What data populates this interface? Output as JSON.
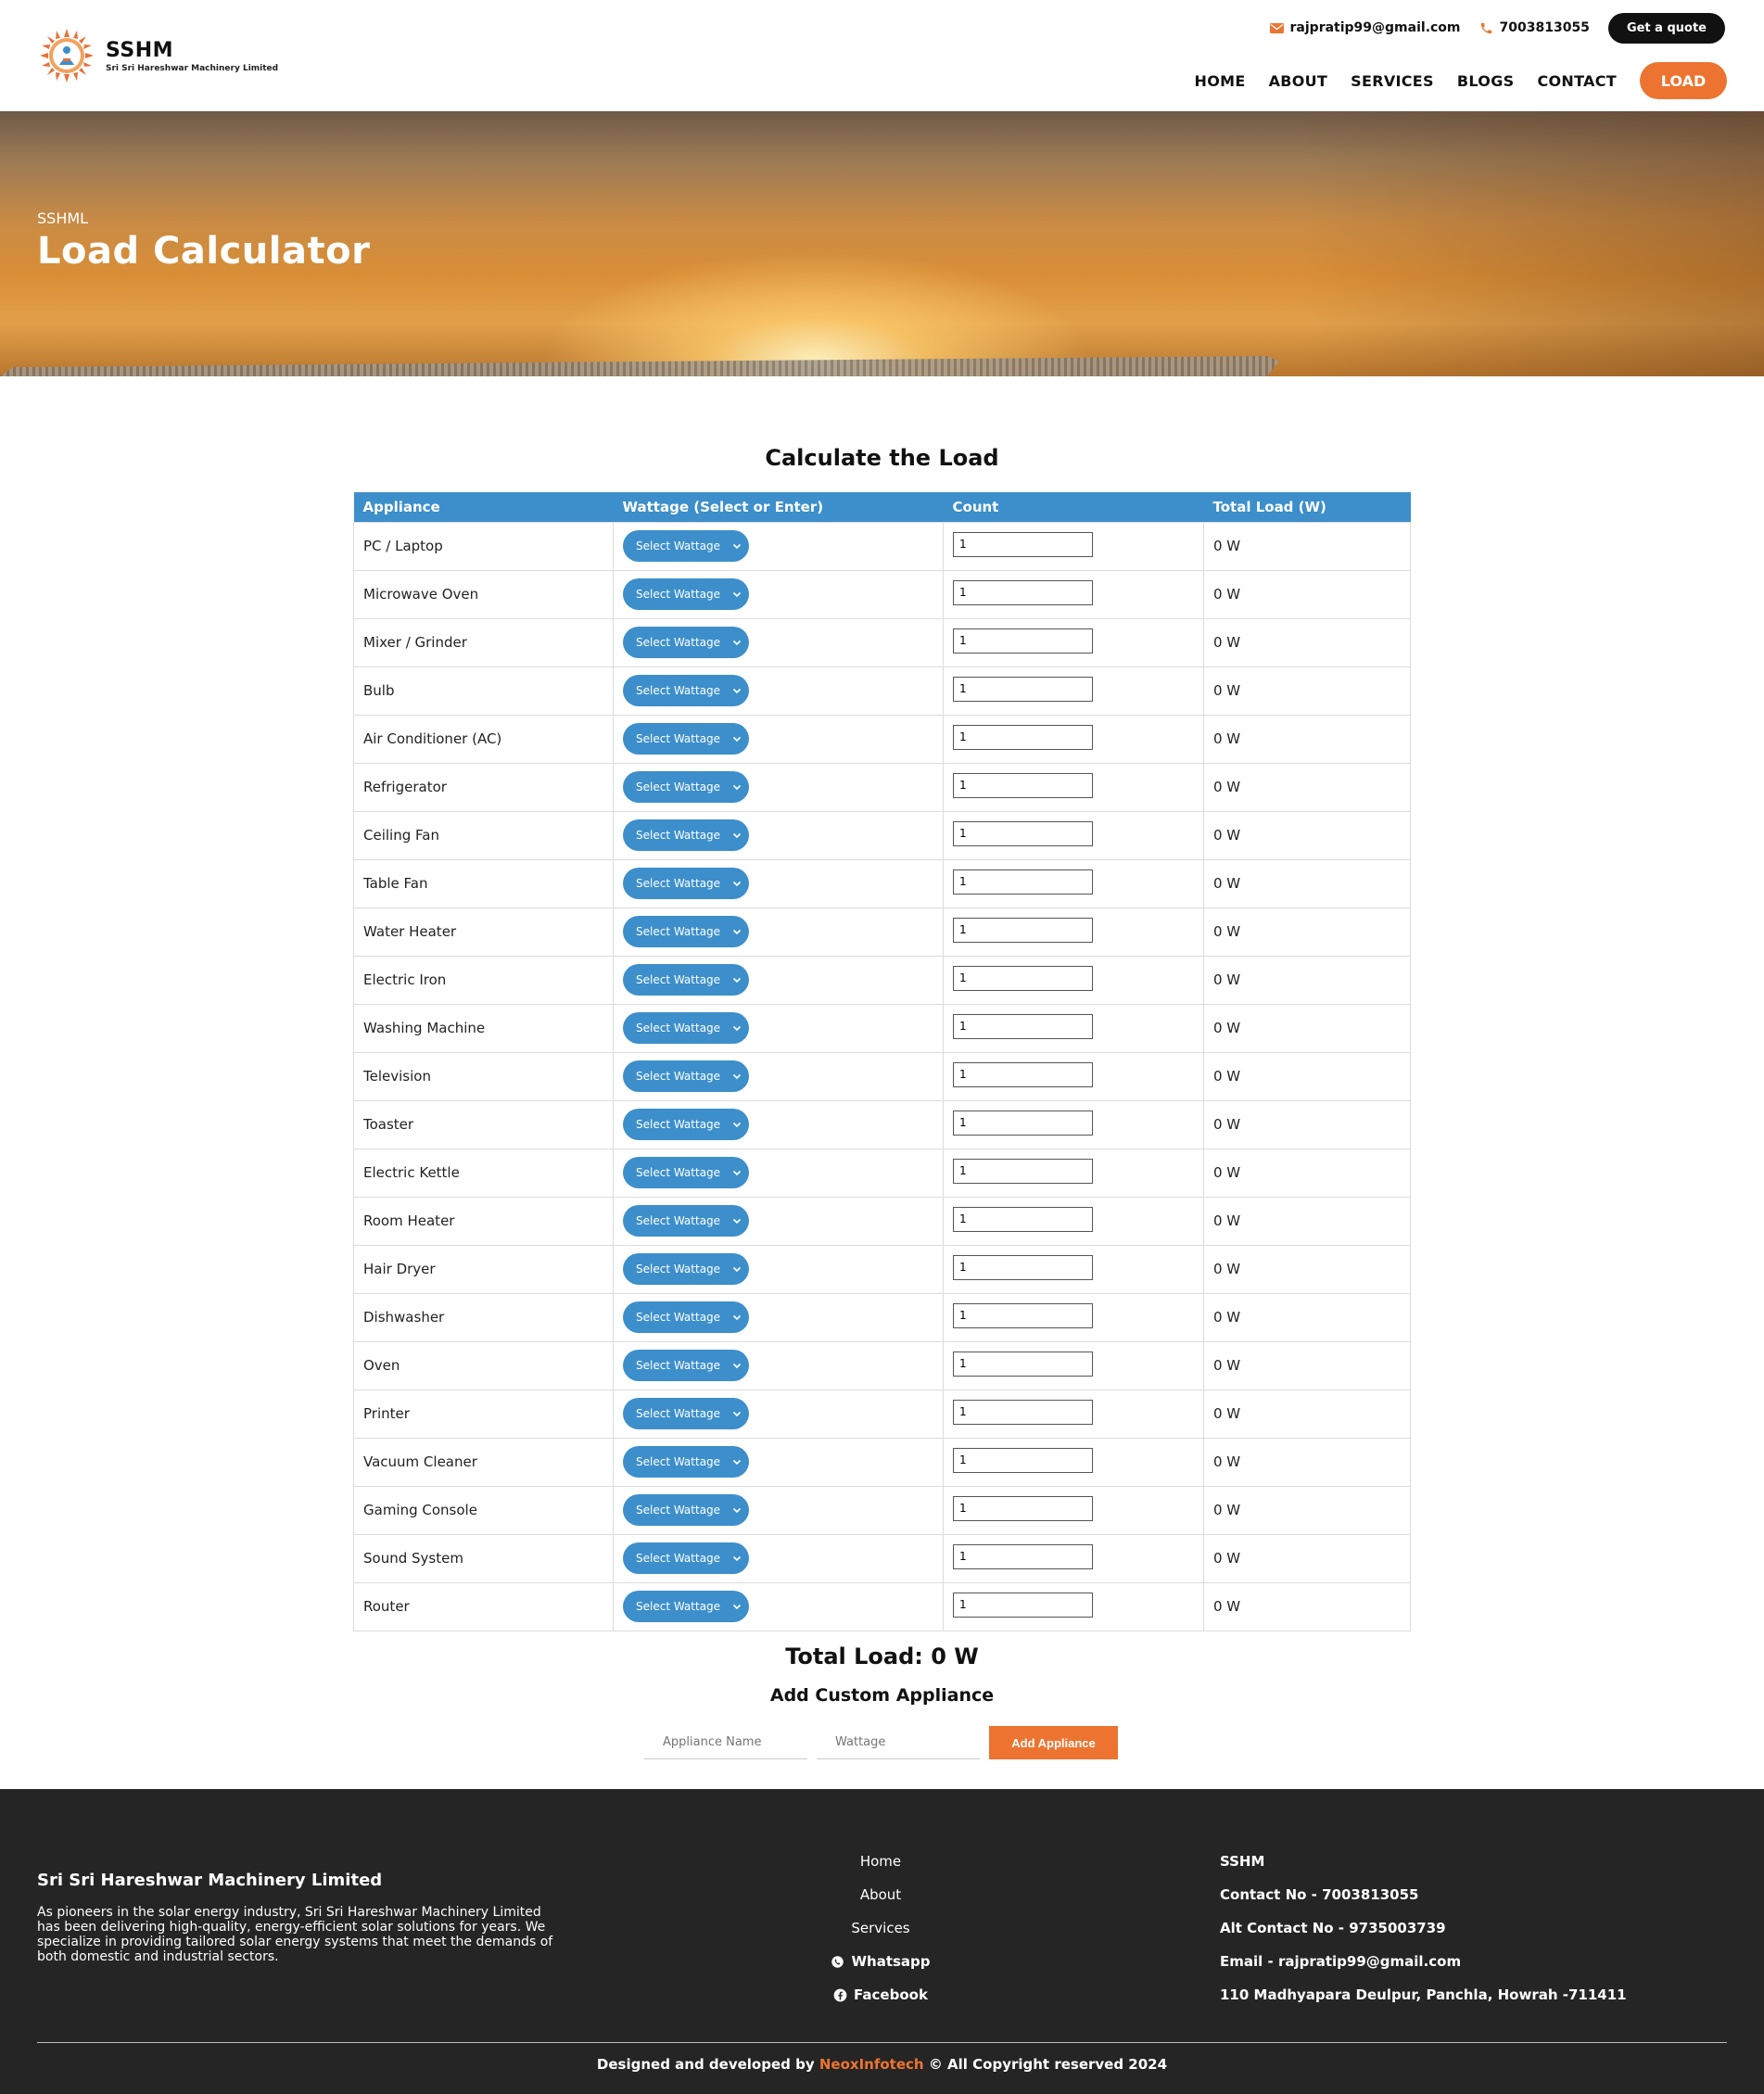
{
  "brand": {
    "name": "SSHM",
    "subtitle": "Sri Sri Hareshwar Machinery Limited"
  },
  "topbar": {
    "email": "rajpratip99@gmail.com",
    "phone": "7003813055",
    "quote_label": "Get a quote"
  },
  "nav": {
    "items": [
      "HOME",
      "ABOUT",
      "SERVICES",
      "BLOGS",
      "CONTACT"
    ],
    "load_label": "LOAD"
  },
  "hero": {
    "crumb": "SSHML",
    "title": "Load Calculator"
  },
  "calculator": {
    "title": "Calculate the Load",
    "headers": [
      "Appliance",
      "Wattage (Select or Enter)",
      "Count",
      "Total Load (W)"
    ],
    "select_label": "Select Wattage",
    "default_count": "1",
    "default_total": "0 W",
    "appliances": [
      "PC / Laptop",
      "Microwave Oven",
      "Mixer / Grinder",
      "Bulb",
      "Air Conditioner (AC)",
      "Refrigerator",
      "Ceiling Fan",
      "Table Fan",
      "Water Heater",
      "Electric Iron",
      "Washing Machine",
      "Television",
      "Toaster",
      "Electric Kettle",
      "Room Heater",
      "Hair Dryer",
      "Dishwasher",
      "Oven",
      "Printer",
      "Vacuum Cleaner",
      "Gaming Console",
      "Sound System",
      "Router"
    ],
    "total_label": "Total Load: 0 W",
    "custom": {
      "title": "Add Custom Appliance",
      "name_placeholder": "Appliance Name",
      "wattage_placeholder": "Wattage",
      "button_label": "Add Appliance"
    }
  },
  "footer": {
    "company": "Sri Sri Hareshwar Machinery Limited",
    "description": "As pioneers in the solar energy industry, Sri Sri Hareshwar Machinery Limited has been delivering high-quality, energy-efficient solar solutions for years. We specialize in providing tailored solar energy systems that meet the demands of both domestic and industrial sectors.",
    "links": [
      "Home",
      "About",
      "Services"
    ],
    "social": [
      "Whatsapp",
      "Facebook"
    ],
    "contact": {
      "title": "SSHM",
      "phone": "Contact No - 7003813055",
      "alt_phone": "Alt Contact No - 9735003739",
      "email": "Email - rajpratip99@gmail.com",
      "address": "110 Madhyapara Deulpur, Panchla, Howrah -711411"
    },
    "copyright_prefix": "Designed and developed by",
    "copyright_brand": "NeoxInfotech",
    "copyright_suffix": "© All Copyright reserved 2024"
  },
  "colors": {
    "accent": "#ec7430",
    "table_header": "#3d8fcb",
    "footer_bg": "#252525"
  },
  "icons": {
    "email": "envelope-icon",
    "phone": "phone-icon",
    "select": "chevron-down-icon",
    "whatsapp": "whatsapp-icon",
    "facebook": "facebook-icon"
  }
}
